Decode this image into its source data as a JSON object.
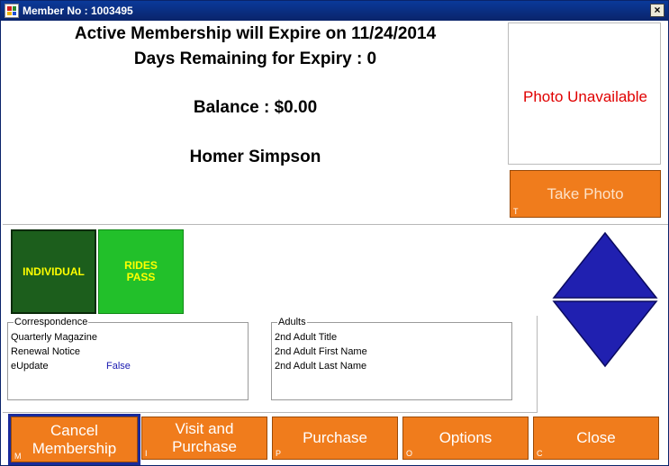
{
  "window": {
    "title": "Member No : 1003495",
    "close_glyph": "×"
  },
  "membership": {
    "expire_text": "Active Membership will Expire on 11/24/2014",
    "days_text": "Days Remaining for Expiry : 0",
    "balance_text": "Balance : $0.00",
    "member_name": "Homer Simpson"
  },
  "photo": {
    "status_text": "Photo Unavailable",
    "take_photo_label": "Take Photo",
    "take_photo_hotkey": "T"
  },
  "tiles": {
    "individual_label": "INDIVIDUAL",
    "rides_line1": "RIDES",
    "rides_line2": "PASS"
  },
  "correspondence": {
    "title": "Correspondence",
    "rows": [
      "Quarterly Magazine",
      "Renewal Notice",
      "eUpdate"
    ],
    "eupdate_value": "False"
  },
  "adults": {
    "title": "Adults",
    "rows": [
      "2nd Adult Title",
      "2nd Adult First Name",
      "2nd Adult Last Name"
    ]
  },
  "buttons": {
    "cancel_line1": "Cancel",
    "cancel_line2": "Membership",
    "cancel_hotkey": "M",
    "visit_line1": "Visit and",
    "visit_line2": "Purchase",
    "visit_hotkey": "I",
    "purchase_label": "Purchase",
    "purchase_hotkey": "P",
    "options_label": "Options",
    "options_hotkey": "O",
    "close_label": "Close",
    "close_hotkey": "C"
  },
  "colors": {
    "title_bar": "#0a246a",
    "button_orange": "#f07c1c",
    "photo_unavailable_red": "#e00000",
    "tile_dark_green": "#1c5e1c",
    "tile_bright_green": "#22c02a",
    "tile_text_yellow": "#ffff00",
    "diamond_blue": "#2020b0",
    "value_blue": "#1a1ab0"
  }
}
